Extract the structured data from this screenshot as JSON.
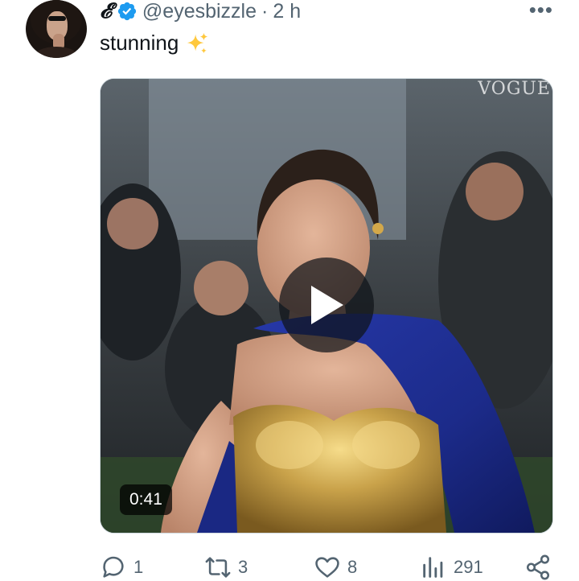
{
  "tweet": {
    "display_name": "𝓔",
    "handle": "@eyesbizzle",
    "separator": "·",
    "time": "2 h",
    "text": "stunning",
    "emoji": "sparkles-icon",
    "more_label": "•••"
  },
  "media": {
    "duration": "0:41",
    "watermark": "VOGUE",
    "play_icon": "play-icon"
  },
  "actions": {
    "replies": "1",
    "retweets": "3",
    "likes": "8",
    "views": "291"
  },
  "colors": {
    "verified": "#1d9bf0",
    "muted_text": "#536471",
    "text": "#0f1419",
    "sparkle": "#ffc83d"
  }
}
